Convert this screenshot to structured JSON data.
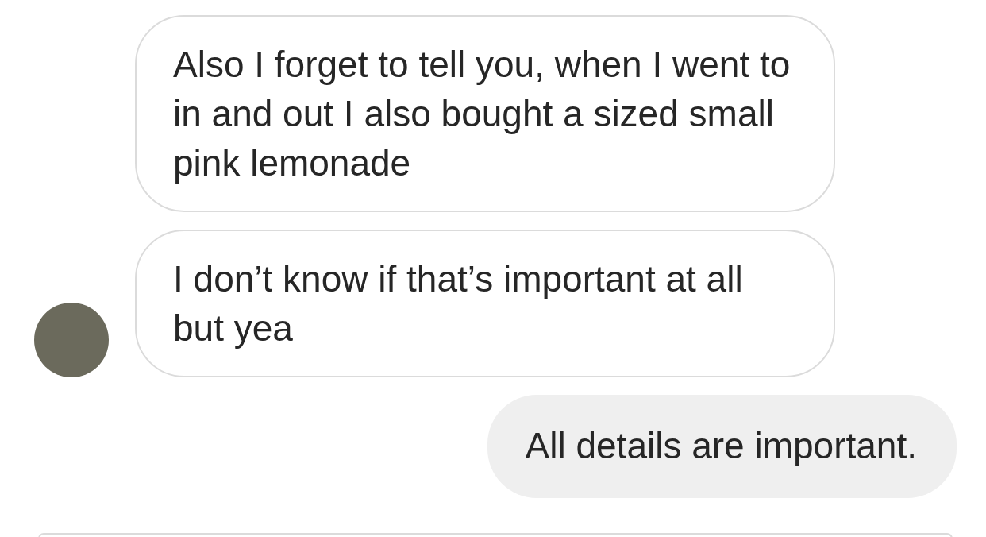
{
  "messages": [
    {
      "kind": "incoming",
      "text": "Also I forget to tell you, when I went to in and out I also bought a sized small pink lemonade",
      "show_avatar": false
    },
    {
      "kind": "incoming",
      "text": "I don’t know if that’s important at all but yea",
      "show_avatar": true
    },
    {
      "kind": "outgoing",
      "text": "All details are important."
    }
  ],
  "composer": {
    "kind": "field"
  }
}
